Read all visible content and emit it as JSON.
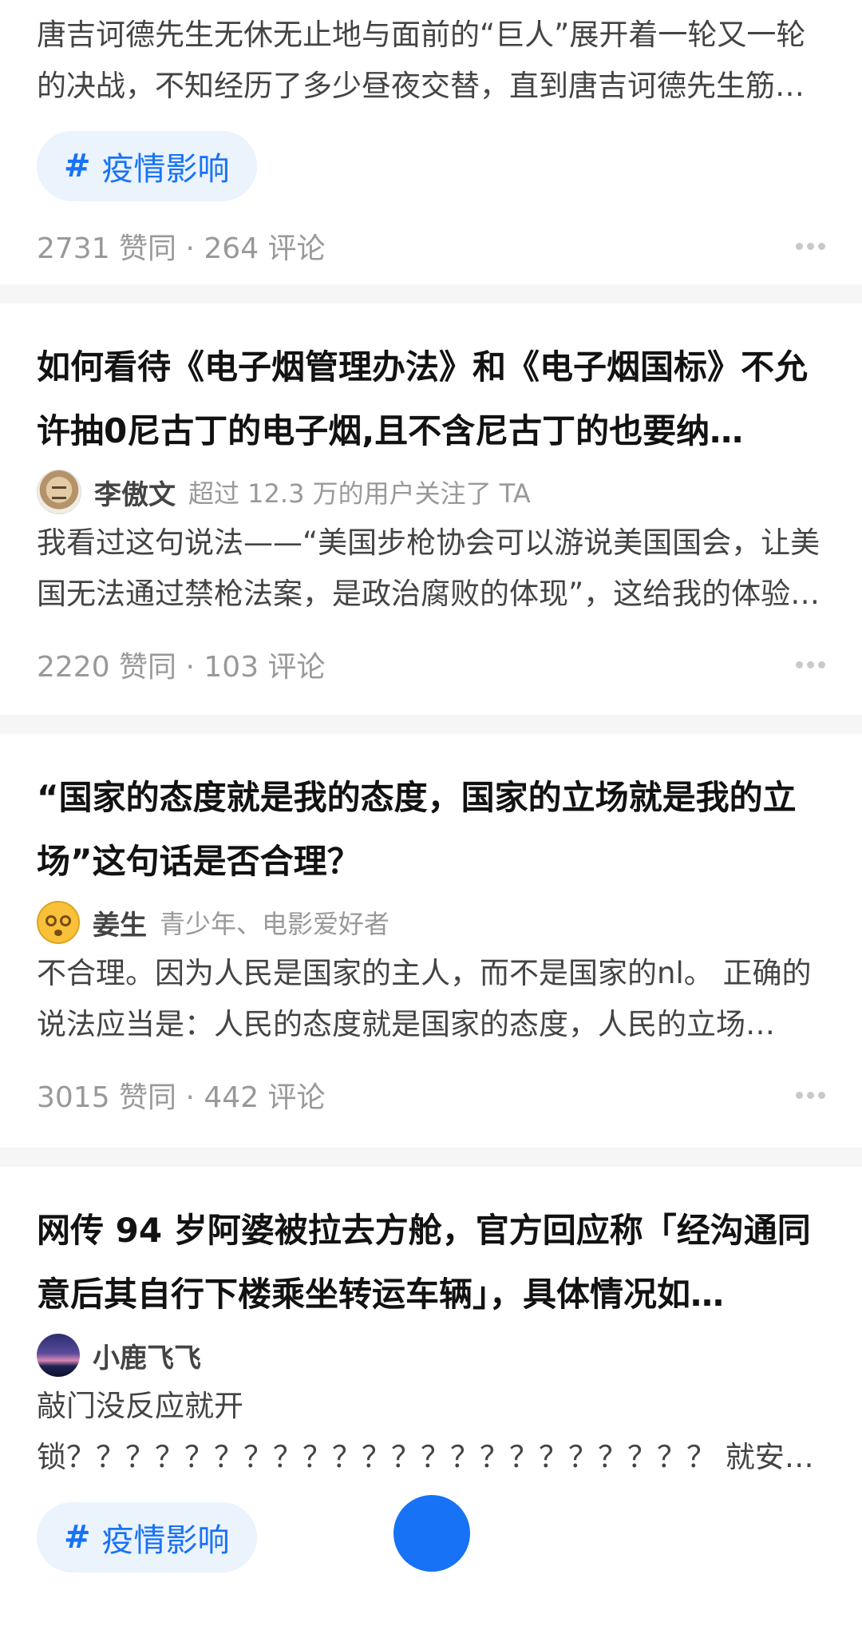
{
  "feed": [
    {
      "excerpt": "唐吉诃德先生无休无止地与面前的“巨人”展开着一轮又一轮的决战，不知经历了多少昼夜交替，直到唐吉诃德先生筋…",
      "tag": "疫情影响",
      "meta": "2731 赞同 · 264 评论"
    },
    {
      "title": "如何看待《电子烟管理办法》和《电子烟国标》不允许抽0尼古丁的电子烟,且不含尼古丁的也要纳…",
      "author": "李傲文",
      "author_desc": "超过 12.3 万的用户关注了 TA",
      "avatar_icon": "tiger-avatar",
      "excerpt": "我看过这句说法——“美国步枪协会可以游说美国国会，让美国无法通过禁枪法案，是政治腐败的体现”，这给我的体验…",
      "meta": "2220 赞同 · 103 评论"
    },
    {
      "title": "“国家的态度就是我的态度，国家的立场就是我的立场”这句话是否合理？",
      "author": "姜生",
      "author_desc": "青少年、电影爱好者",
      "avatar_icon": "dizzy-face-emoji-avatar",
      "excerpt": "不合理。因为人民是国家的主人，而不是国家的nl。 正确的说法应当是：人民的态度就是国家的态度，人民的立场…",
      "meta": "3015 赞同 · 442 评论"
    },
    {
      "title": "网传 94 岁阿婆被拉去方舱，官方回应称「经沟通同意后其自行下楼乘坐转运车辆」，具体情况如…",
      "author": "小鹿飞飞",
      "avatar_icon": "night-sky-avatar",
      "excerpt": "敲门没反应就开锁？？？？？？？？？？？？？？？？？？？？？？ 就安排…",
      "tag": "疫情影响"
    }
  ],
  "hash_symbol": "#",
  "colors": {
    "accent": "#1772f6",
    "tag_bg": "#ebf3fd",
    "meta_text": "#999999",
    "title_text": "#121212",
    "divider": "#f6f6f6"
  }
}
